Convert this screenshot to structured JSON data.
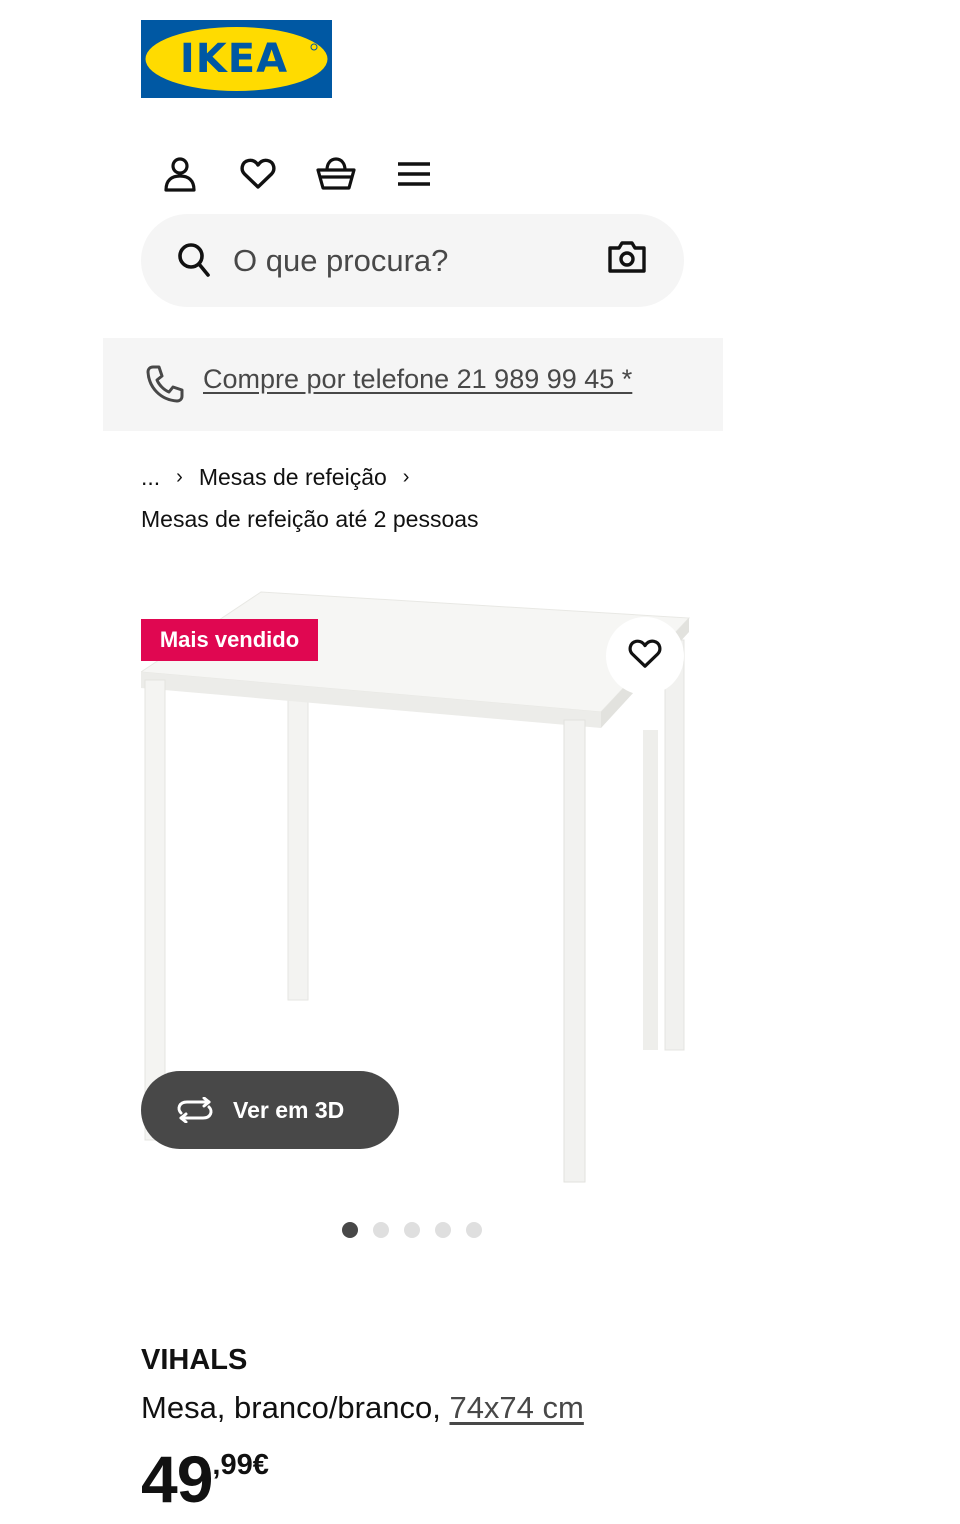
{
  "brand": {
    "logo_text": "IKEA",
    "colors": {
      "blue": "#0058a3",
      "yellow": "#ffdb00"
    }
  },
  "header": {
    "icons": [
      "profile-icon",
      "heart-icon",
      "basket-icon",
      "menu-icon"
    ]
  },
  "search": {
    "placeholder": "O que procura?"
  },
  "phone": {
    "text": "Compre por telefone 21 989 99 45 *"
  },
  "breadcrumb": {
    "ellipsis": "...",
    "category": "Mesas de refeição",
    "subcategory": "Mesas de refeição até 2 pessoas"
  },
  "gallery": {
    "badge": "Mais vendido",
    "view3d_label": "Ver em 3D",
    "image_count": 5,
    "active_index": 0
  },
  "product": {
    "name": "VIHALS",
    "description": "Mesa, branco/branco,",
    "size_link": "74x74 cm",
    "price_integer": "49",
    "price_decimal": ",99€"
  },
  "colors": {
    "badge": "#e00751",
    "dark": "#484848",
    "light_bg": "#f5f5f5"
  }
}
